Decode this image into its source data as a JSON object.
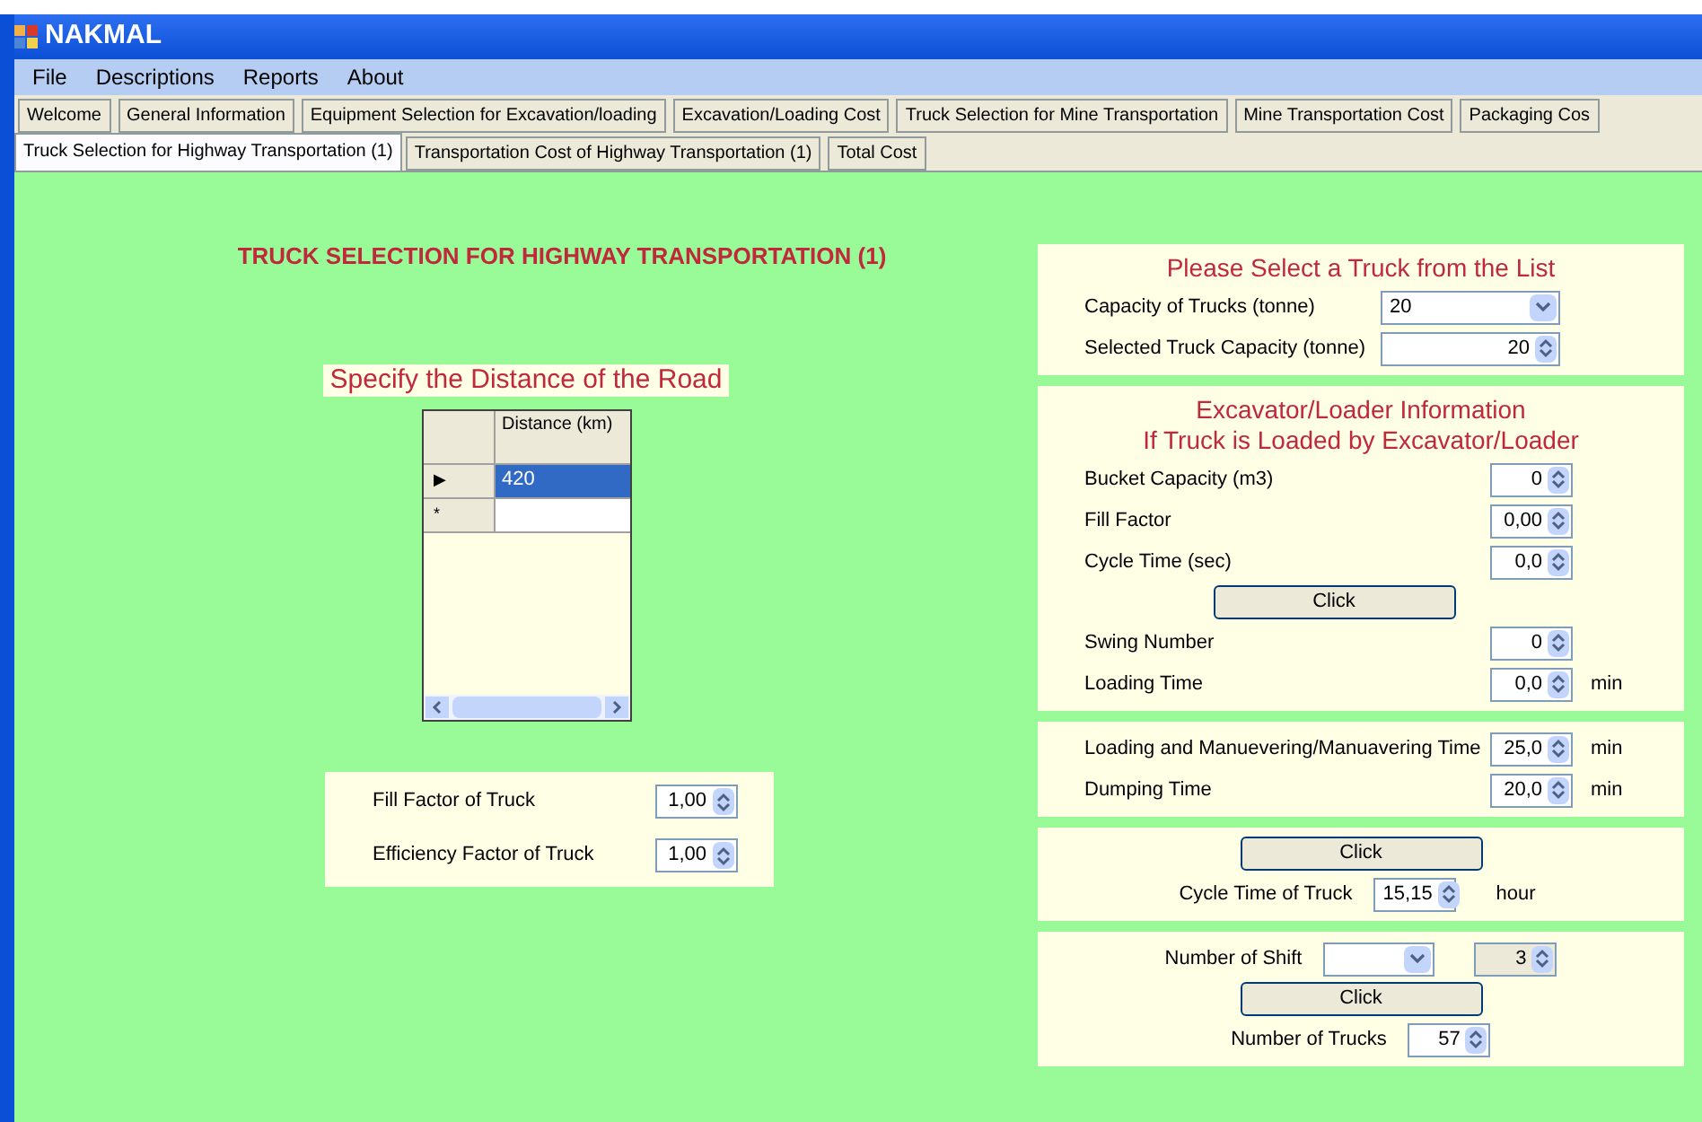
{
  "window": {
    "title": "NAKMAL"
  },
  "menu": [
    "File",
    "Descriptions",
    "Reports",
    "About"
  ],
  "tabs_row1": [
    {
      "label": "Welcome",
      "selected": false
    },
    {
      "label": "General Information",
      "selected": false
    },
    {
      "label": "Equipment Selection for Excavation/loading",
      "selected": false
    },
    {
      "label": "Excavation/Loading Cost",
      "selected": false
    },
    {
      "label": "Truck Selection for Mine Transportation",
      "selected": false
    },
    {
      "label": "Mine Transportation Cost",
      "selected": false
    },
    {
      "label": "Packaging Cos",
      "selected": false
    }
  ],
  "tabs_row2": [
    {
      "label": "Truck Selection for Highway Transportation (1)",
      "selected": true
    },
    {
      "label": "Transportation Cost of Highway Transportation (1)",
      "selected": false
    },
    {
      "label": "Total Cost",
      "selected": false
    }
  ],
  "heading": "TRUCK SELECTION FOR HIGHWAY TRANSPORTATION (1)",
  "distance": {
    "title": "Specify the Distance of the Road",
    "column": "Distance (km)",
    "rows": [
      {
        "marker": "▶",
        "value": "420",
        "selected": true
      },
      {
        "marker": "*",
        "selected": false
      }
    ]
  },
  "factors": [
    {
      "label": "Fill Factor of Truck",
      "value": "1,00"
    },
    {
      "label": "Efficiency Factor of Truck",
      "value": "1,00"
    }
  ],
  "panels": [
    {
      "kind": "form",
      "title_lines": [
        "Please Select a Truck from the List"
      ],
      "rows": [
        {
          "kind": "field",
          "label": "Capacity of Trucks (tonne)",
          "controls": [
            {
              "kind": "combo",
              "value": "20",
              "disabled": false
            }
          ]
        },
        {
          "kind": "field",
          "label": "Selected Truck Capacity (tonne)",
          "controls": [
            {
              "kind": "spinner",
              "value": "20",
              "disabled": false
            }
          ]
        }
      ]
    },
    {
      "kind": "form",
      "title_lines": [
        "Excavator/Loader Information",
        "If Truck is Loaded by Excavator/Loader"
      ],
      "rows": [
        {
          "kind": "field",
          "label": "Bucket Capacity (m3)",
          "controls": [
            {
              "kind": "spinner",
              "value": "0",
              "disabled": false
            }
          ]
        },
        {
          "kind": "field",
          "label": "Fill Factor",
          "controls": [
            {
              "kind": "spinner",
              "value": "0,00",
              "disabled": false
            }
          ]
        },
        {
          "kind": "field",
          "label": "Cycle Time (sec)",
          "controls": [
            {
              "kind": "spinner",
              "value": "0,0",
              "disabled": false
            }
          ]
        },
        {
          "kind": "button",
          "label": "Click"
        },
        {
          "kind": "field",
          "label": "Swing Number",
          "controls": [
            {
              "kind": "spinner",
              "value": "0",
              "disabled": false
            }
          ]
        },
        {
          "kind": "field",
          "label": "Loading Time",
          "controls": [
            {
              "kind": "spinner",
              "value": "0,0",
              "disabled": false
            }
          ],
          "unit": "min"
        }
      ]
    },
    {
      "kind": "form",
      "rows": [
        {
          "kind": "field",
          "label": "Loading and Manuevering/Manuavering Time",
          "controls": [
            {
              "kind": "spinner",
              "value": "25,0",
              "disabled": false
            }
          ],
          "unit": "min"
        },
        {
          "kind": "field",
          "label": "Dumping Time",
          "controls": [
            {
              "kind": "spinner",
              "value": "20,0",
              "disabled": false
            }
          ],
          "unit": "min"
        }
      ]
    },
    {
      "kind": "centered",
      "rows": [
        {
          "kind": "button",
          "label": "Click"
        },
        {
          "kind": "field",
          "label": "Cycle Time of Truck",
          "controls": [
            {
              "kind": "spinner",
              "value": "15,15",
              "disabled": false
            }
          ],
          "unit": "hour"
        }
      ]
    },
    {
      "kind": "centered",
      "rows": [
        {
          "kind": "field",
          "label": "Number of Shift",
          "controls": [
            {
              "kind": "combo",
              "disabled": false
            },
            {
              "kind": "spinner",
              "value": "3",
              "disabled": true
            }
          ]
        },
        {
          "kind": "button",
          "label": "Click"
        },
        {
          "kind": "field",
          "label": "Number of Trucks",
          "controls": [
            {
              "kind": "spinner",
              "value": "57",
              "disabled": false
            }
          ]
        }
      ]
    }
  ]
}
